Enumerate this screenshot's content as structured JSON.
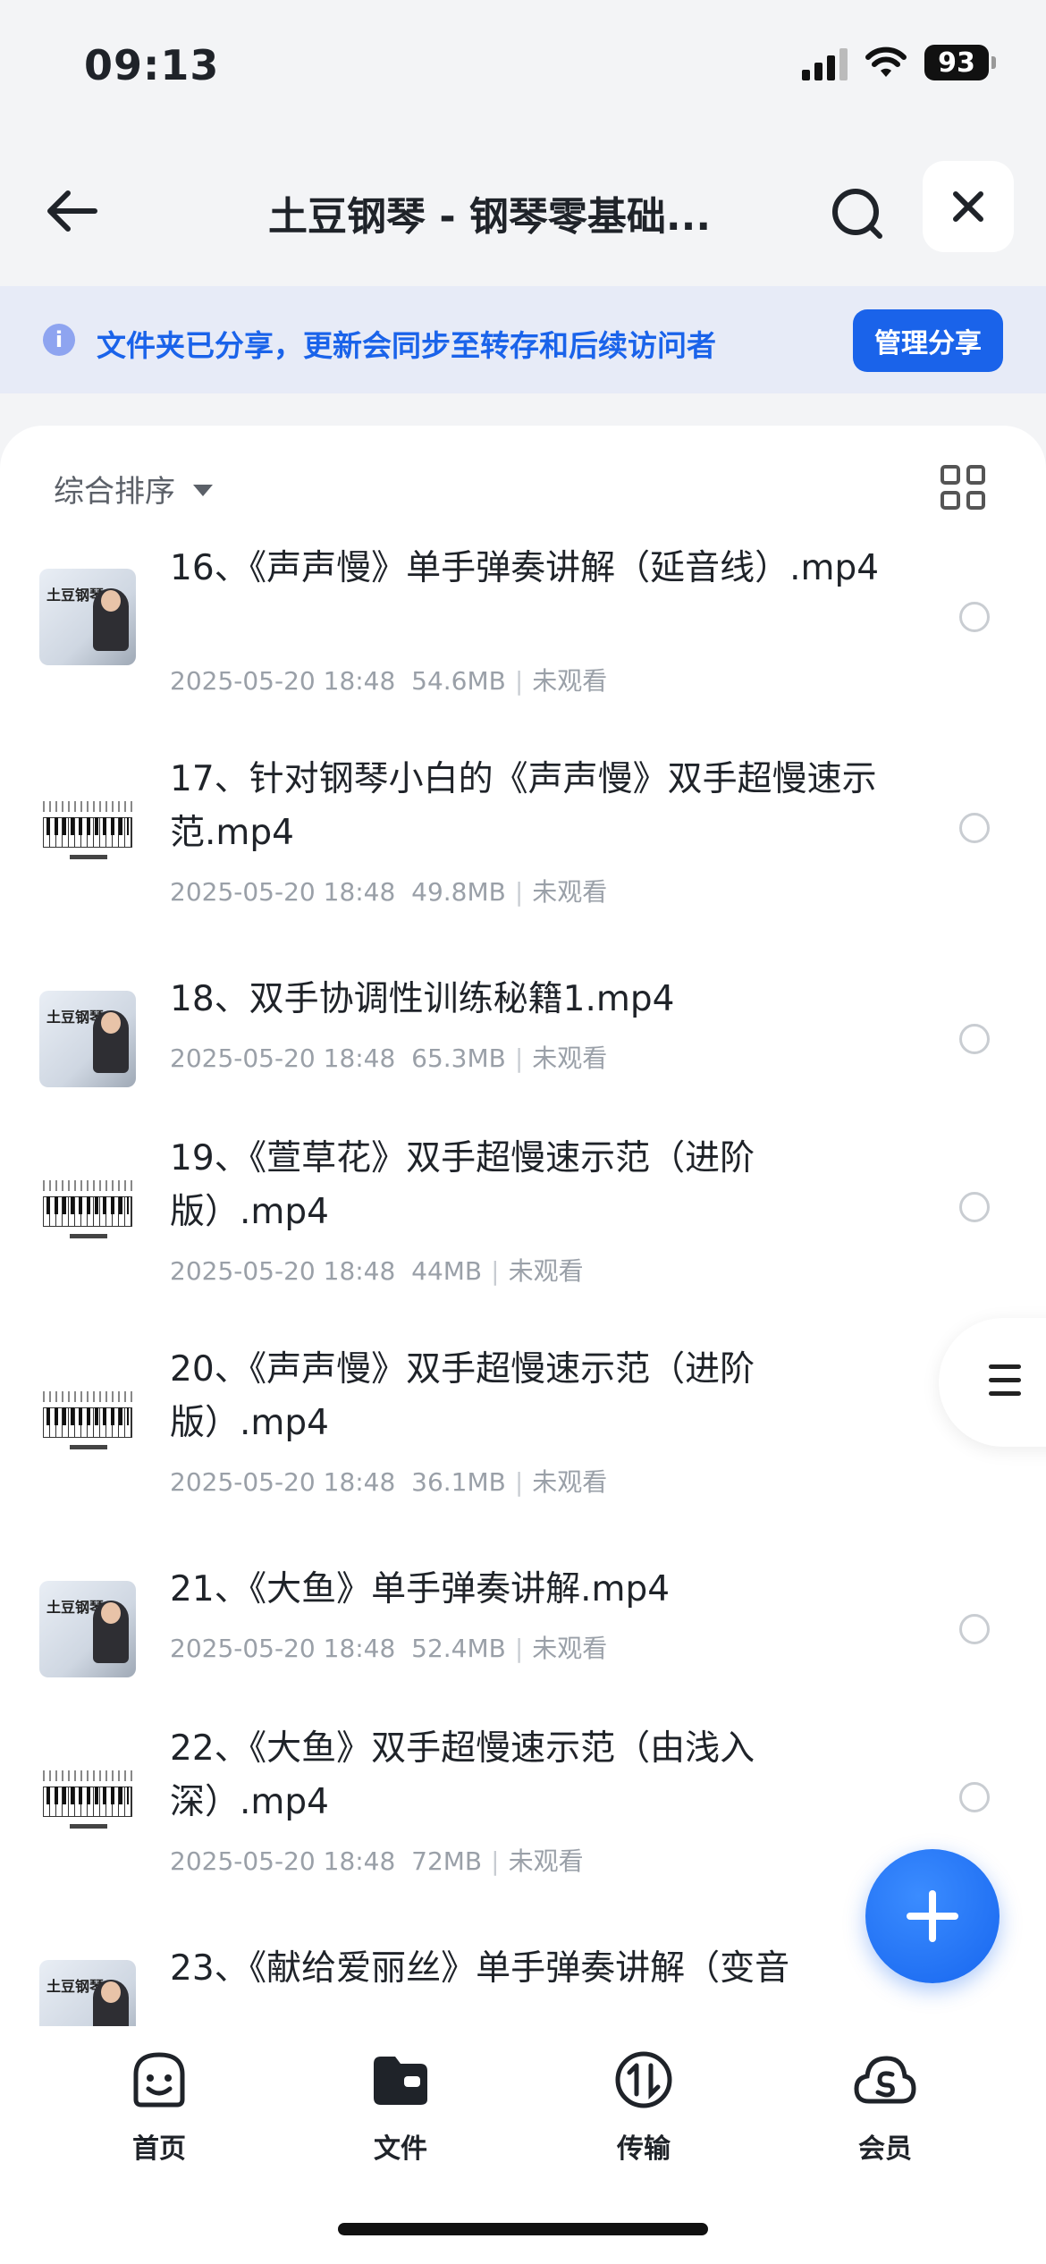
{
  "status_bar": {
    "time": "09:13",
    "battery": "93"
  },
  "nav": {
    "title": "土豆钢琴 - 钢琴零基础..."
  },
  "banner": {
    "text": "文件夹已分享，更新会同步至转存和后续访问者",
    "button": "管理分享"
  },
  "sort": {
    "label": "综合排序"
  },
  "files": [
    {
      "name": "16、《声声慢》单手弹奏讲解（延音线）.mp4",
      "date": "2025-05-20 18:48",
      "size": "54.6MB",
      "status": "未观看",
      "thumb": "video"
    },
    {
      "name": "17、针对钢琴小白的《声声慢》双手超慢速示范.mp4",
      "date": "2025-05-20 18:48",
      "size": "49.8MB",
      "status": "未观看",
      "thumb": "piano"
    },
    {
      "name": "18、双手协调性训练秘籍1.mp4",
      "date": "2025-05-20 18:48",
      "size": "65.3MB",
      "status": "未观看",
      "thumb": "video"
    },
    {
      "name": "19、《萱草花》双手超慢速示范（进阶版）.mp4",
      "date": "2025-05-20 18:48",
      "size": "44MB",
      "status": "未观看",
      "thumb": "piano"
    },
    {
      "name": "20、《声声慢》双手超慢速示范（进阶版）.mp4",
      "date": "2025-05-20 18:48",
      "size": "36.1MB",
      "status": "未观看",
      "thumb": "piano"
    },
    {
      "name": "21、《大鱼》单手弹奏讲解.mp4",
      "date": "2025-05-20 18:48",
      "size": "52.4MB",
      "status": "未观看",
      "thumb": "video"
    },
    {
      "name": "22、《大鱼》双手超慢速示范（由浅入深）.mp4",
      "date": "2025-05-20 18:48",
      "size": "72MB",
      "status": "未观看",
      "thumb": "piano"
    },
    {
      "name": "23、《献给爱丽丝》单手弹奏讲解（变音",
      "date": "",
      "size": "",
      "status": "",
      "thumb": "video"
    }
  ],
  "thumb_text": "土豆钢琴",
  "tabs": [
    {
      "label": "首页",
      "icon": "smile-face-icon"
    },
    {
      "label": "文件",
      "icon": "folder-icon"
    },
    {
      "label": "传输",
      "icon": "transfer-icon"
    },
    {
      "label": "会员",
      "icon": "cloud-vip-icon"
    }
  ],
  "colors": {
    "accent": "#1a63ea",
    "banner_bg": "#e7ebf7",
    "meta": "#9aa0a8"
  }
}
